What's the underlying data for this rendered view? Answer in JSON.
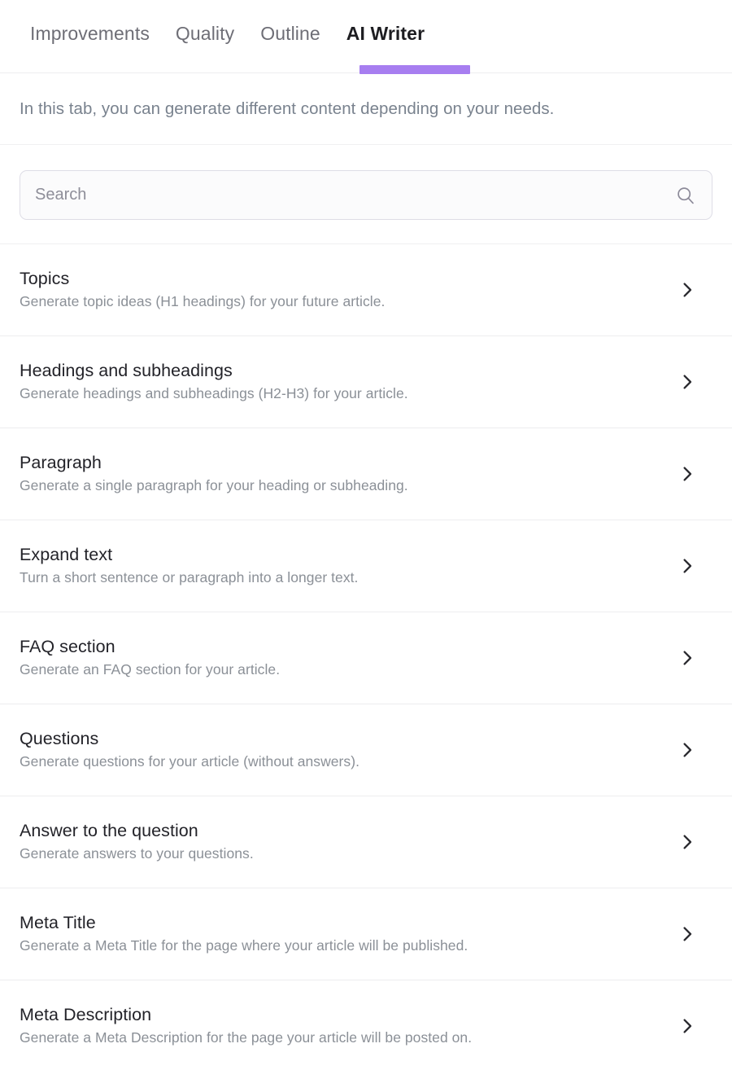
{
  "tabs": [
    {
      "label": "Improvements",
      "active": false
    },
    {
      "label": "Quality",
      "active": false
    },
    {
      "label": "Outline",
      "active": false
    },
    {
      "label": "AI Writer",
      "active": true
    }
  ],
  "subtitle": "In this tab, you can generate different content depending on your needs.",
  "search": {
    "placeholder": "Search",
    "value": "",
    "icon": "search-icon"
  },
  "accent_color": "#a77ef0",
  "colors": {
    "accent": "#a77ef0",
    "title": "#232329",
    "description": "#8b9097",
    "subtitle": "#79828e",
    "divider": "#ededef",
    "tab_inactive": "#6e6e76",
    "tab_active": "#1d1d21",
    "search_border": "#dedde6",
    "search_background": "#fbfbfc",
    "search_placeholder": "#8e8e99"
  },
  "items": [
    {
      "title": "Topics",
      "description": "Generate topic ideas (H1 headings) for your future article.",
      "chevron": "chevron-right-icon"
    },
    {
      "title": "Headings and subheadings",
      "description": "Generate headings and subheadings (H2-H3) for your article.",
      "chevron": "chevron-right-icon"
    },
    {
      "title": "Paragraph",
      "description": "Generate a single paragraph for your heading or subheading.",
      "chevron": "chevron-right-icon"
    },
    {
      "title": "Expand text",
      "description": "Turn a short sentence or paragraph into a longer text.",
      "chevron": "chevron-right-icon"
    },
    {
      "title": "FAQ section",
      "description": "Generate an FAQ section for your article.",
      "chevron": "chevron-right-icon"
    },
    {
      "title": "Questions",
      "description": "Generate questions for your article (without answers).",
      "chevron": "chevron-right-icon"
    },
    {
      "title": "Answer to the question",
      "description": "Generate answers to your questions.",
      "chevron": "chevron-right-icon"
    },
    {
      "title": "Meta Title",
      "description": "Generate a Meta Title for the page where your article will be published.",
      "chevron": "chevron-right-icon"
    },
    {
      "title": "Meta Description",
      "description": "Generate a Meta Description for the page your article will be posted on.",
      "chevron": "chevron-right-icon"
    }
  ]
}
